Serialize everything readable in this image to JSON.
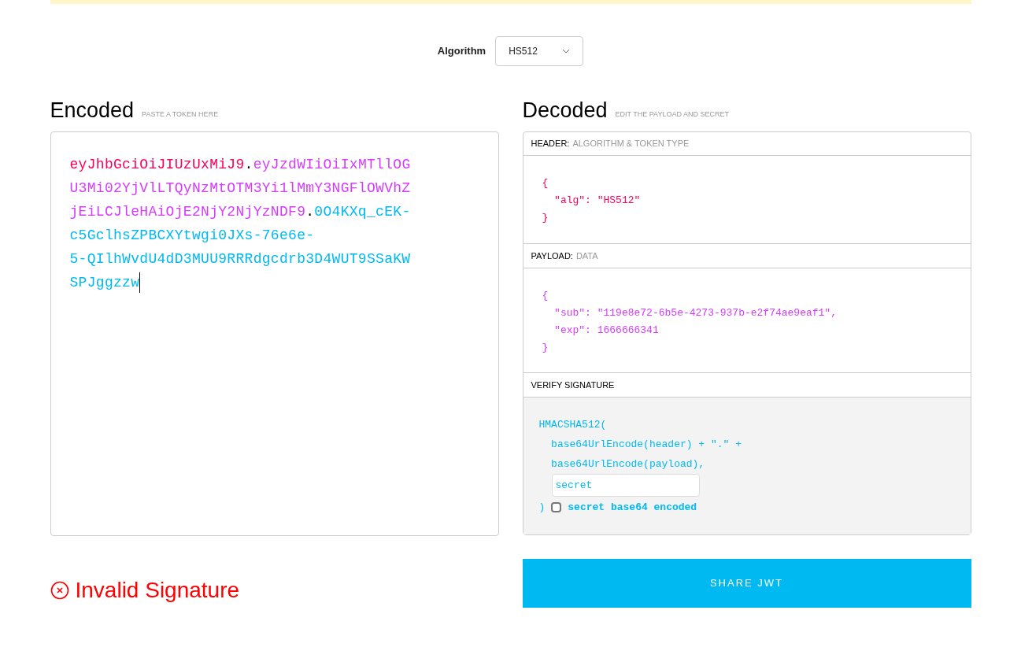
{
  "algorithm": {
    "label": "Algorithm",
    "value": "HS512"
  },
  "encoded": {
    "title": "Encoded",
    "hint": "PASTE A TOKEN HERE",
    "lines": [
      [
        {
          "kind": "header",
          "text": "eyJhbGciOiJIUzUxMiJ9"
        },
        {
          "kind": "dot",
          "text": "."
        },
        {
          "kind": "payload",
          "text": "eyJzdWIiOiIxMTllOG"
        }
      ],
      [
        {
          "kind": "payload",
          "text": "U3Mi02YjVlLTQyNzMtOTM3Yi1lMmY3NGFlOWVhZ"
        }
      ],
      [
        {
          "kind": "payload",
          "text": "jEiLCJleHAiOjE2NjY2NjYzNDF9"
        },
        {
          "kind": "dot",
          "text": "."
        },
        {
          "kind": "signature",
          "text": "0O4KXq_cEK-"
        }
      ],
      [
        {
          "kind": "signature",
          "text": "c5GclhsZPBCXYtwgi0JXs-76e6e-"
        }
      ],
      [
        {
          "kind": "signature",
          "text": "5-QIlhWvdU4dD3MUU9RRRdgcdrb3D4WUT9SSaKW"
        }
      ],
      [
        {
          "kind": "signature",
          "text": "SPJggzzw"
        }
      ]
    ]
  },
  "decoded": {
    "title": "Decoded",
    "hint": "EDIT THE PAYLOAD AND SECRET",
    "header": {
      "label": "HEADER:",
      "hint": "ALGORITHM & TOKEN TYPE",
      "lines": [
        "{",
        "  \"alg\": \"HS512\"",
        "}"
      ]
    },
    "payload": {
      "label": "PAYLOAD:",
      "hint": "DATA",
      "lines": [
        "{",
        "  \"sub\": \"119e8e72-6b5e-4273-937b-e2f74ae9eaf1\",",
        "  \"exp\": 1666666341",
        "}"
      ]
    },
    "verify": {
      "label": "VERIFY SIGNATURE",
      "lines": [
        "HMACSHA512(",
        "  base64UrlEncode(header) + \".\" +",
        "  base64UrlEncode(payload),"
      ],
      "secret": "secret",
      "close": ")",
      "base64_checkbox": {
        "label": "secret base64 encoded",
        "checked": false
      }
    }
  },
  "status": {
    "kind": "invalid",
    "text": "Invalid Signature"
  },
  "share_button": "SHARE JWT"
}
